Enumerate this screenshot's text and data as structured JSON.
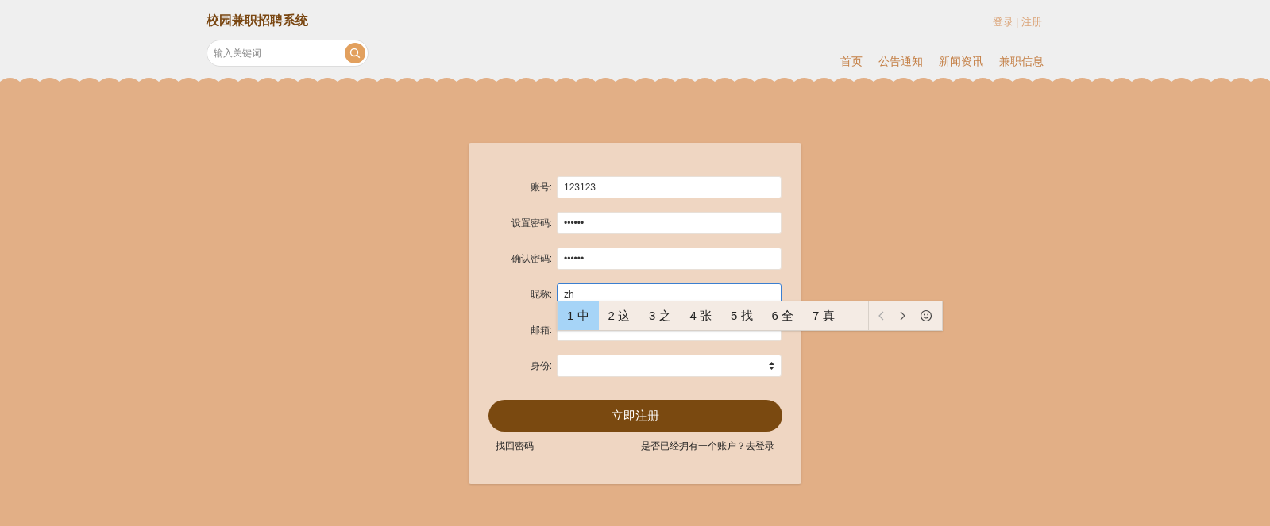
{
  "header": {
    "title": "校园兼职招聘系统",
    "auth_links": [
      "登录",
      "注册"
    ],
    "auth_separator": "|",
    "search": {
      "placeholder": "输入关键词"
    },
    "nav": [
      {
        "label": "首页"
      },
      {
        "label": "公告通知"
      },
      {
        "label": "新闻资讯"
      },
      {
        "label": "兼职信息"
      }
    ]
  },
  "form": {
    "fields": [
      {
        "label": "账号:",
        "kind": "text",
        "value": "123123",
        "focused": false
      },
      {
        "label": "设置密码:",
        "kind": "text",
        "value": "••••••",
        "focused": false
      },
      {
        "label": "确认密码:",
        "kind": "text",
        "value": "••••••",
        "focused": false
      },
      {
        "label": "昵称:",
        "kind": "text",
        "value": "zh",
        "focused": true
      },
      {
        "label": "邮箱:",
        "kind": "text",
        "focused": false
      },
      {
        "label": "身份:",
        "kind": "select",
        "focused": false
      }
    ],
    "submit": "立即注册",
    "forgot_link": "找回密码",
    "login_prompt": "是否已经拥有一个账户？去登录"
  },
  "ime_popup": {
    "candidates": [
      {
        "number": "1",
        "text": "中",
        "selected": true
      },
      {
        "number": "2",
        "text": "这",
        "selected": false
      },
      {
        "number": "3",
        "text": "之",
        "selected": false
      },
      {
        "number": "4",
        "text": "张",
        "selected": false
      },
      {
        "number": "5",
        "text": "找",
        "selected": false
      },
      {
        "number": "6",
        "text": "全",
        "selected": false
      },
      {
        "number": "7",
        "text": "真",
        "selected": false
      }
    ]
  }
}
